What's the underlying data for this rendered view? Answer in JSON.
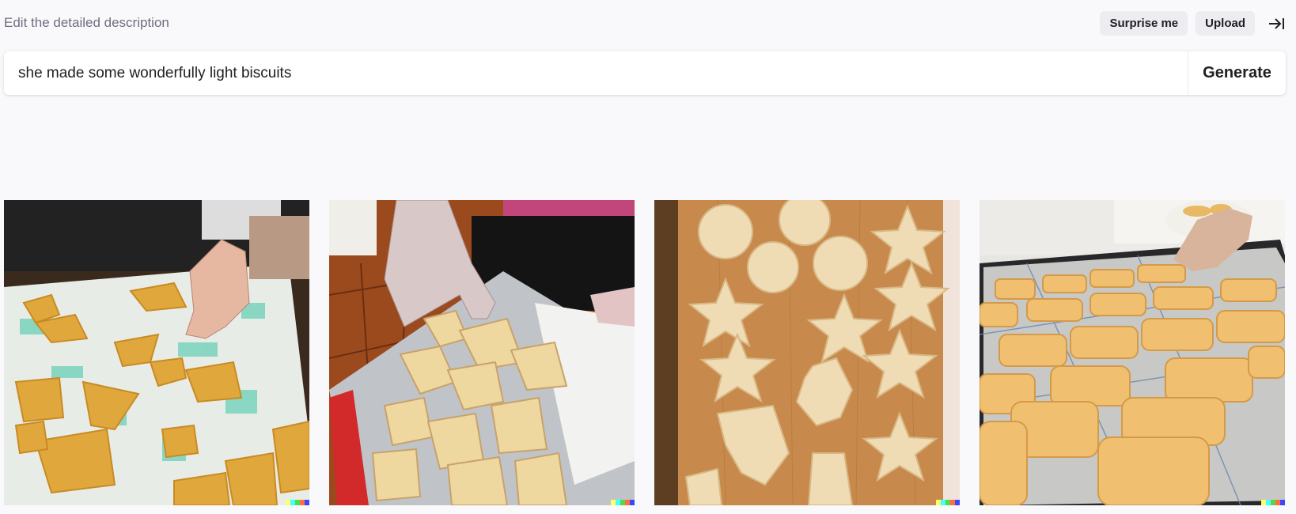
{
  "header": {
    "title": "Edit the detailed description",
    "surprise_label": "Surprise me",
    "upload_label": "Upload",
    "collapse_icon": "arrow-right-to-bar-icon"
  },
  "prompt": {
    "value": "she made some wonderfully light biscuits",
    "generate_label": "Generate"
  },
  "results": {
    "count": 4,
    "items": [
      {
        "subject": "biscuits on teal patterned cloth with hand"
      },
      {
        "subject": "hand placing biscuits on foil-lined tray"
      },
      {
        "subject": "star and flower biscuits on wooden board"
      },
      {
        "subject": "rectangular biscuits on cooling rack tray"
      }
    ],
    "signature_colors": [
      "#ffff66",
      "#42ffff",
      "#51da4c",
      "#ff6e3c",
      "#3c46ff"
    ]
  }
}
